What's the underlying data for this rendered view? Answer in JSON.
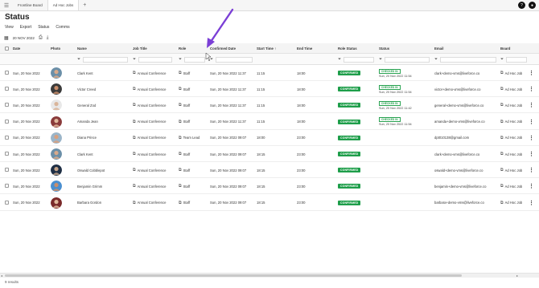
{
  "tabs": [
    "Frontline Board",
    "Ad Hoc Jobs"
  ],
  "tab_add": "+",
  "topbar_right": {
    "help": "?",
    "user": "●"
  },
  "page_title": "Status",
  "subnav": [
    "View",
    "Export",
    "Status",
    "Comms"
  ],
  "toolbar": {
    "date": "20 NOV 2022"
  },
  "columns": {
    "date": "Date",
    "photo": "Photo",
    "name": "Name",
    "job_title": "Job Title",
    "role": "Role",
    "confirmed_date": "Confirmed Date",
    "start_time": "Start Time",
    "end_time": "End Time",
    "role_status": "Role Status",
    "status": "Status",
    "email": "Email",
    "board": "Board"
  },
  "sort_indicator": "↑",
  "rows": [
    {
      "date": "Sun, 20 Nov 2022",
      "name": "Clark Kent",
      "job_title": "Annual Conference",
      "role": "Staff",
      "confirmed": "Sun, 20 Nov 2022 11:37",
      "start": "11:15",
      "end": "18:00",
      "role_status": "CONFIRMED",
      "status_badge": "CHECKED IN",
      "status_time": "Sun, 20 Nov 2022 11:54",
      "email": "clark+demo-vms@liveforce.co",
      "board": "Ad Hoc Job",
      "avatar_bg": "#6b8fa8",
      "avatar_skin": "#d8a98a"
    },
    {
      "date": "Sun, 20 Nov 2022",
      "name": "Victor Creed",
      "job_title": "Annual Conference",
      "role": "Staff",
      "confirmed": "Sun, 20 Nov 2022 11:37",
      "start": "11:15",
      "end": "18:00",
      "role_status": "CONFIRMED",
      "status_badge": "CHECKED IN",
      "status_time": "Sun, 20 Nov 2022 11:54",
      "email": "victor+demo-vms@liveforce.co",
      "board": "Ad Hoc Job",
      "avatar_bg": "#3b3b3b",
      "avatar_skin": "#c98e6b"
    },
    {
      "date": "Sun, 20 Nov 2022",
      "name": "General Zod",
      "job_title": "Annual Conference",
      "role": "Staff",
      "confirmed": "Sun, 20 Nov 2022 11:37",
      "start": "11:15",
      "end": "18:00",
      "role_status": "CONFIRMED",
      "status_badge": "CHECKED IN",
      "status_time": "Sun, 20 Nov 2022 11:42",
      "email": "general+demo-vms@liveforce.co",
      "board": "Ad Hoc Job",
      "avatar_bg": "#e8e8e8",
      "avatar_skin": "#d9b59a"
    },
    {
      "date": "Sun, 20 Nov 2022",
      "name": "Amanda Jean",
      "job_title": "Annual Conference",
      "role": "Staff",
      "confirmed": "Sun, 20 Nov 2022 11:37",
      "start": "11:15",
      "end": "18:00",
      "role_status": "CONFIRMED",
      "status_badge": "CHECKED IN",
      "status_time": "Sun, 20 Nov 2022 11:54",
      "email": "amanda+demo-vms@liveforce.co",
      "board": "Ad Hoc Job",
      "avatar_bg": "#8a3b3b",
      "avatar_skin": "#e0b89c"
    },
    {
      "date": "Sun, 20 Nov 2022",
      "name": "Diana Prince",
      "job_title": "Annual Conference",
      "role": "Team Lead",
      "confirmed": "Sun, 20 Nov 2022 09:07",
      "start": "18:00",
      "end": "23:00",
      "role_status": "CONFIRMED",
      "status_badge": "",
      "status_time": "",
      "email": "dpt010138@gmail.com",
      "board": "Ad Hoc Job",
      "avatar_bg": "#9bb5c9",
      "avatar_skin": "#d9a07e"
    },
    {
      "date": "Sun, 20 Nov 2022",
      "name": "Clark Kent",
      "job_title": "Annual Conference",
      "role": "Staff",
      "confirmed": "Sun, 20 Nov 2022 09:07",
      "start": "18:15",
      "end": "23:00",
      "role_status": "CONFIRMED",
      "status_badge": "",
      "status_time": "",
      "email": "clark+demo-vms@liveforce.co",
      "board": "Ad Hoc Job",
      "avatar_bg": "#6b8fa8",
      "avatar_skin": "#d8a98a"
    },
    {
      "date": "Sun, 20 Nov 2022",
      "name": "Oswald Cobblepot",
      "job_title": "Annual Conference",
      "role": "Staff",
      "confirmed": "Sun, 20 Nov 2022 09:07",
      "start": "18:15",
      "end": "23:00",
      "role_status": "CONFIRMED",
      "status_badge": "",
      "status_time": "",
      "email": "oswald+demo-vms@liveforce.co",
      "board": "Ad Hoc Job",
      "avatar_bg": "#1f2f45",
      "avatar_skin": "#c4a48a"
    },
    {
      "date": "Sun, 20 Nov 2022",
      "name": "Benjamin Grimm",
      "job_title": "Annual Conference",
      "role": "Staff",
      "confirmed": "Sun, 20 Nov 2022 09:07",
      "start": "18:15",
      "end": "23:00",
      "role_status": "CONFIRMED",
      "status_badge": "",
      "status_time": "",
      "email": "benjamin+demo-vms@liveforce.co",
      "board": "Ad Hoc Job",
      "avatar_bg": "#4a8fd0",
      "avatar_skin": "#c98e6b"
    },
    {
      "date": "Sun, 20 Nov 2022",
      "name": "Barbara Gordon",
      "job_title": "Annual Conference",
      "role": "Staff",
      "confirmed": "Sun, 20 Nov 2022 09:07",
      "start": "18:15",
      "end": "23:00",
      "role_status": "CONFIRMED",
      "status_badge": "",
      "status_time": "",
      "email": "barbara+demo-vms@liveforce.co",
      "board": "Ad Hoc Job",
      "avatar_bg": "#7a2a2a",
      "avatar_skin": "#e0b89c"
    }
  ],
  "footer": {
    "results": "9 results"
  },
  "colors": {
    "confirmed": "#1e9e4a",
    "checked_in": "#2aa352",
    "arrow": "#7b3fd6"
  }
}
